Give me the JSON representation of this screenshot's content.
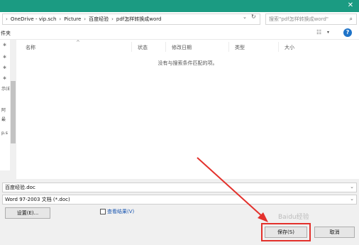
{
  "window": {
    "close_glyph": "✕"
  },
  "address_bar": {
    "separator": "›",
    "breadcrumbs": [
      "OneDrive - vip.sch",
      "Picture",
      "百度经验",
      "pdf怎样转换成word"
    ],
    "dropdown_glyph": "⌄",
    "refresh_glyph": "↻"
  },
  "search": {
    "placeholder": "搜索\"pdf怎样转换成word\"",
    "icon": "search-icon",
    "icon_glyph": "⌕"
  },
  "toolbar": {
    "new_folder_label": "件夹",
    "view_glyph": "☷",
    "view_dropdown_glyph": "▾",
    "help_glyph": "?"
  },
  "nav_pane": {
    "pin_glyph": "✱",
    "items": [
      "件夹",
      "",
      "",
      "",
      "示(E",
      "阿",
      "最",
      "p.s"
    ],
    "scroll_down_glyph": "⌄"
  },
  "file_list": {
    "columns": [
      "名称",
      "状态",
      "修改日期",
      "类型",
      "大小"
    ],
    "sort_indicator": "^",
    "empty_message": "没有与搜索条件匹配的项。"
  },
  "save_panel": {
    "filename_value": "百度经验.doc",
    "filetype_value": "Word 97-2003 文档 (*.doc)",
    "field_dropdown_glyph": "⌄",
    "tools_button": "设置(E)...",
    "view_results_label": "查看结果(V)",
    "save_button": "保存(S)",
    "cancel_button": "取消"
  },
  "annotation": {
    "highlight_color": "#e3312c",
    "arrow_color": "#e3312c"
  },
  "watermark": {
    "text": "Baidu经验"
  },
  "colors": {
    "titlebar": "#1b9b82",
    "help": "#1e73c8"
  }
}
